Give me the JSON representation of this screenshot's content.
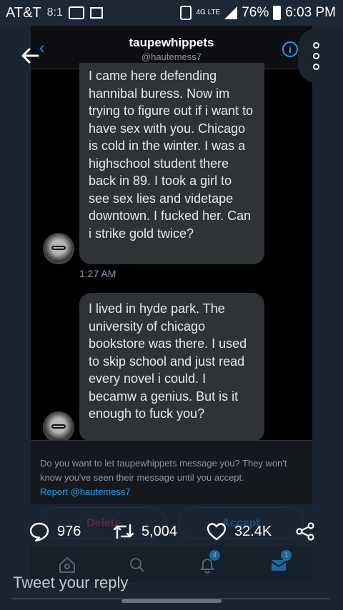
{
  "status_bar": {
    "carrier": "AT&T",
    "secondary_time": "8:1",
    "network": "4G LTE",
    "battery": "76%",
    "time": "6:03 PM"
  },
  "header": {
    "title": "taupewhippets",
    "handle": "@hautemess7",
    "back_glyph": "‹",
    "info_glyph": "i"
  },
  "messages": [
    {
      "text": "I came here defending hannibal buress.  Now im trying to figure out if i want to have sex with you.  Chicago is cold in the winter.  I was a highschool student there back in 89. I took a girl to see sex lies and videtape downtown. I fucked her.  Can i strike gold twice?",
      "timestamp": "1:27 AM"
    },
    {
      "text": "I lived in hyde park.  The university of chicago bookstore was there.  I used to skip school and just read every novel i could.  I becamw a genius.  But is it enough to fuck you?"
    }
  ],
  "request": {
    "prompt": "Do you want to let taupewhippets message you? They won't know you've seen their message until you accept.",
    "report_link": "Report @hautemess7",
    "delete_label": "Delete",
    "accept_label": "Accept"
  },
  "tweet_actions": {
    "replies": "976",
    "retweets": "5,004",
    "likes": "32.4K"
  },
  "tabs": {
    "notifications_badge": "4",
    "messages_badge": "1"
  },
  "reply": {
    "placeholder": "Tweet your reply"
  },
  "colors": {
    "accent": "#1da1f2",
    "bubble": "#2f3336",
    "background": "#1a2533"
  },
  "icons": [
    "back-arrow-icon",
    "chevron-left-icon",
    "info-icon",
    "more-vertical-icon",
    "reply-icon",
    "retweet-icon",
    "heart-icon",
    "share-icon",
    "home-icon",
    "search-icon",
    "bell-icon",
    "mail-icon"
  ]
}
